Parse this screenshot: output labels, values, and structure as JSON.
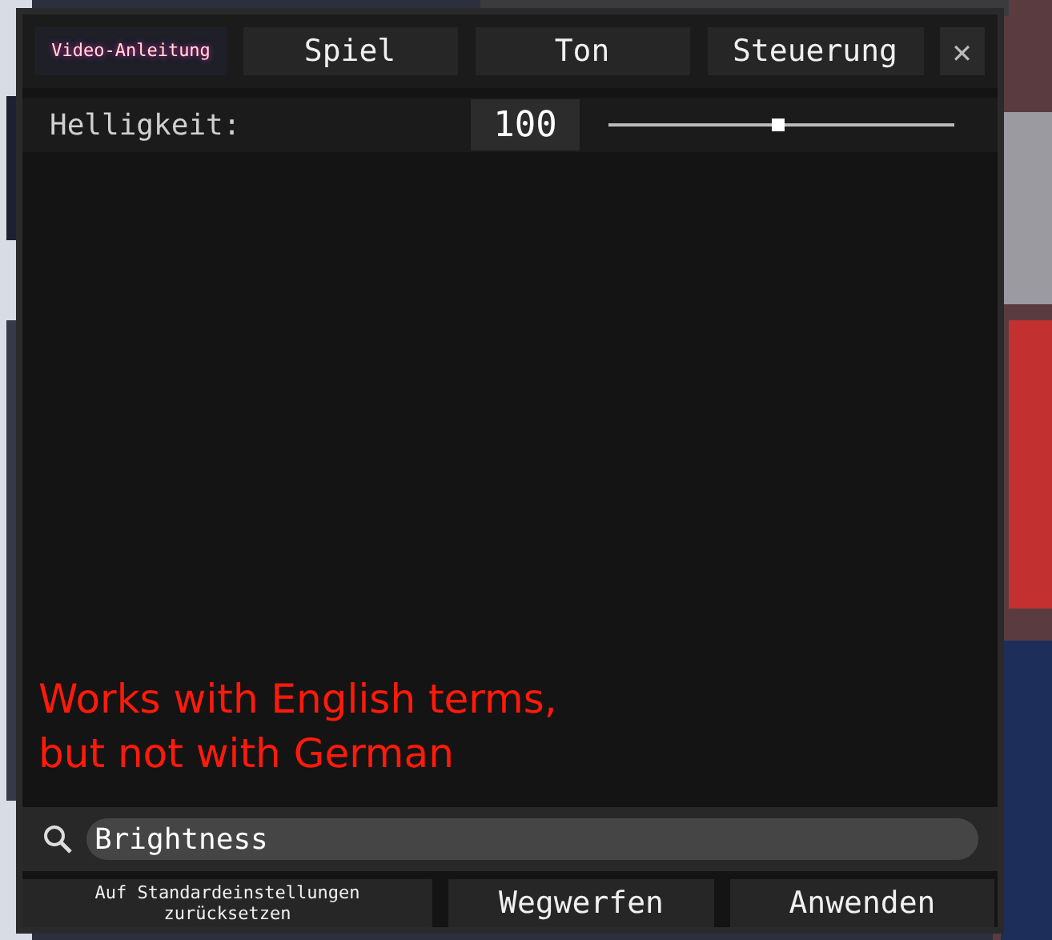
{
  "header": {
    "guide_link": "Video-Anleitung",
    "tabs": [
      {
        "label": "Spiel"
      },
      {
        "label": "Ton"
      },
      {
        "label": "Steuerung"
      }
    ],
    "close": "✕"
  },
  "setting": {
    "label": "Helligkeit:",
    "value": "100",
    "level": 0.49
  },
  "annotation": {
    "lines": [
      "Works with English terms,",
      "but not with German"
    ]
  },
  "search": {
    "value": "Brightness"
  },
  "buttons": [
    "Auf Standardeinstellungen zurücksetzen",
    "Wegwerfen",
    "Anwenden"
  ]
}
